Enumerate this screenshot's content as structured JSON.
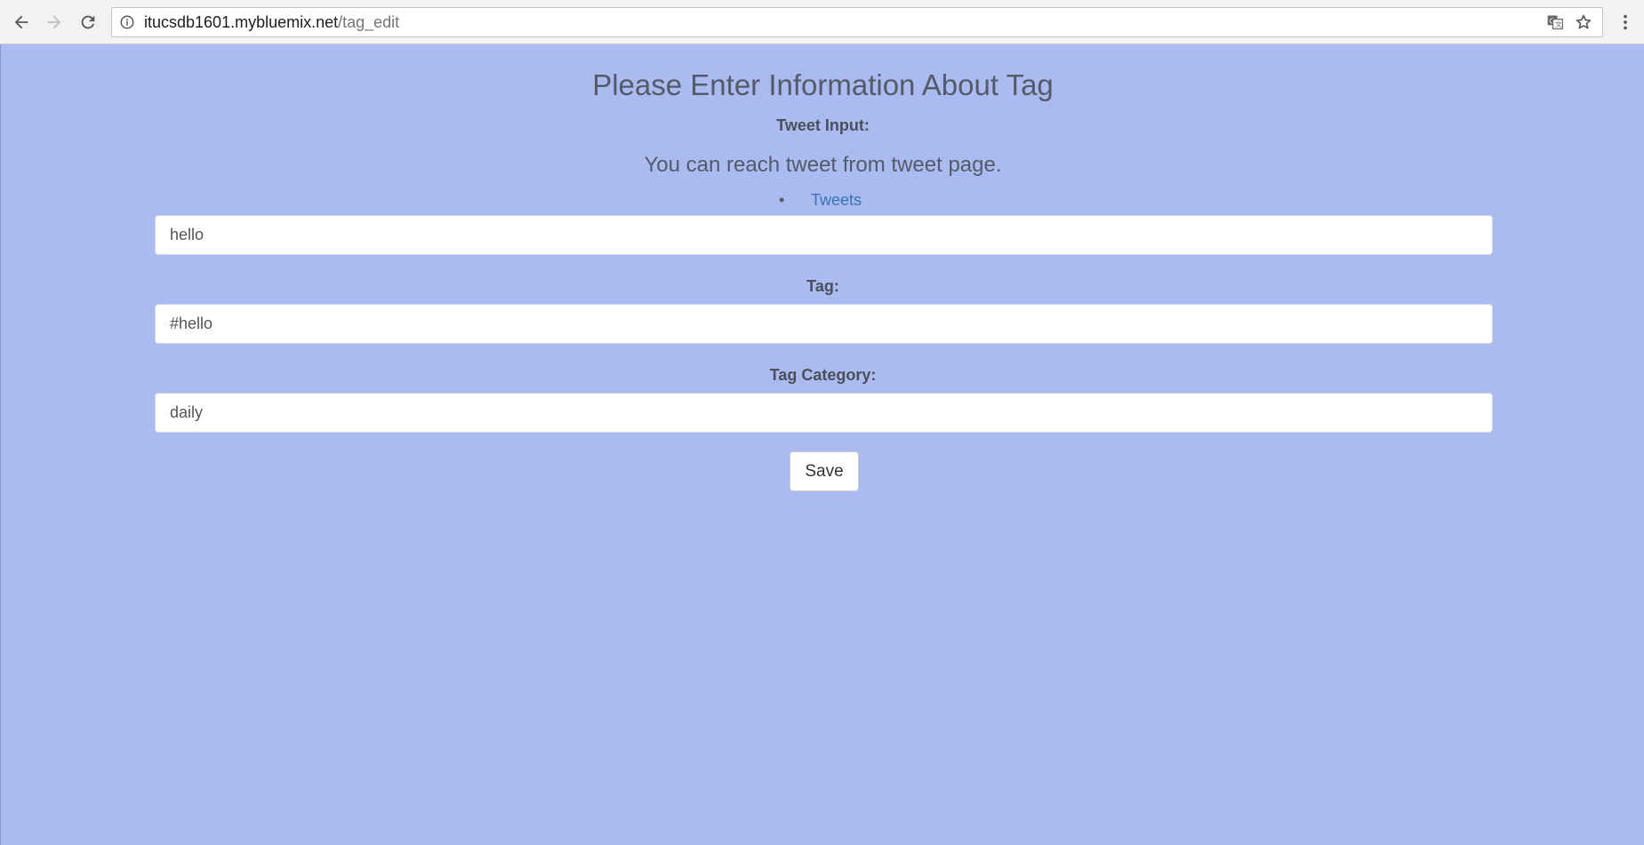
{
  "browser": {
    "url_host": "itucsdb1601.mybluemix.net",
    "url_path": "/tag_edit",
    "icons": {
      "back": "arrow-left-icon",
      "forward": "arrow-right-icon",
      "reload": "reload-icon",
      "info": "info-icon",
      "translate": "translate-icon",
      "bookmark": "star-icon",
      "menu": "kebab-menu-icon"
    }
  },
  "page": {
    "title": "Please Enter Information About Tag",
    "tweet_input_label": "Tweet Input:",
    "note": "You can reach tweet from tweet page.",
    "links": [
      {
        "label": "Tweets"
      }
    ],
    "tweet_input_value": "hello",
    "tag_label": "Tag:",
    "tag_value": "#hello",
    "tag_category_label": "Tag Category:",
    "tag_category_value": "daily",
    "save_label": "Save"
  },
  "colors": {
    "page_background": "#a9bbf0",
    "link": "#3a73b4",
    "text": "#555b66"
  }
}
